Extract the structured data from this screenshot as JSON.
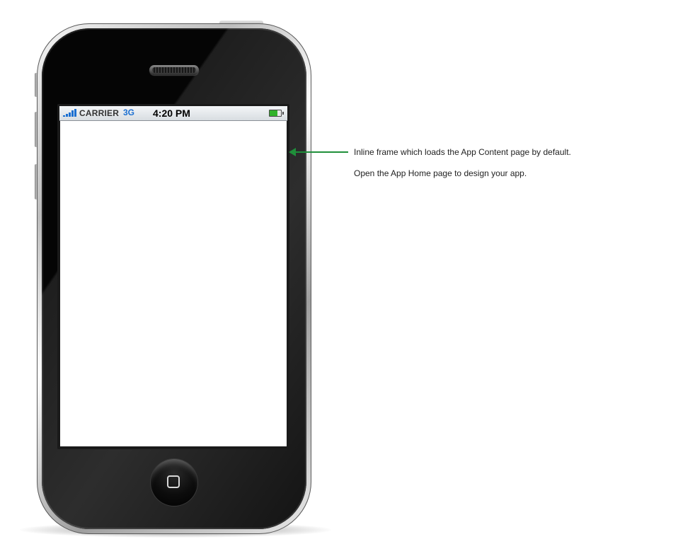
{
  "status_bar": {
    "carrier": "CARRIER",
    "network": "3G",
    "time": "4:20 PM",
    "signal_icon": "signal-bars-icon",
    "battery_icon": "battery-icon"
  },
  "annotation": {
    "line1": "Inline frame which loads the App Content page by default.",
    "line2": "Open the App Home page to design your app.",
    "arrow_icon": "arrow-left-icon"
  },
  "colors": {
    "arrow": "#1f8f3a",
    "signal": "#1b6fd1",
    "battery_fill": "#31b22a",
    "phone_body": "#050505"
  }
}
